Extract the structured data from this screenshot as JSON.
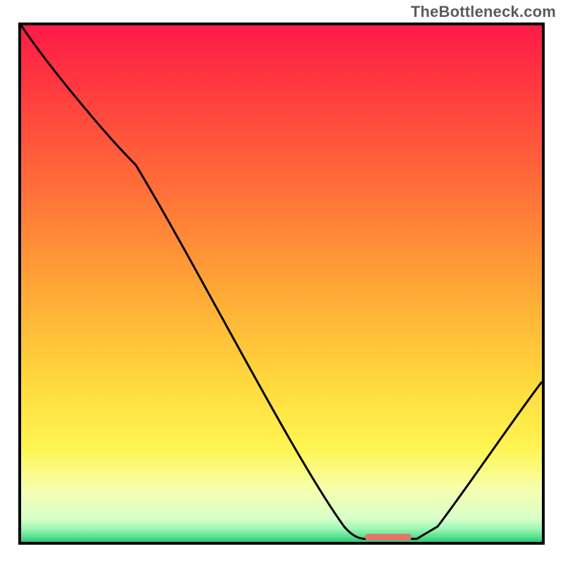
{
  "watermark": "TheBottleneck.com",
  "chart_data": {
    "type": "line",
    "title": "",
    "xlabel": "",
    "ylabel": "",
    "xlim": [
      0,
      100
    ],
    "ylim": [
      0,
      100
    ],
    "gradient_stops": [
      {
        "offset": 0,
        "color": "#ff1a47"
      },
      {
        "offset": 0.12,
        "color": "#ff3a3f"
      },
      {
        "offset": 0.3,
        "color": "#ff6a3a"
      },
      {
        "offset": 0.5,
        "color": "#ffa436"
      },
      {
        "offset": 0.68,
        "color": "#ffd63c"
      },
      {
        "offset": 0.82,
        "color": "#fff552"
      },
      {
        "offset": 0.9,
        "color": "#f6ffb0"
      },
      {
        "offset": 0.955,
        "color": "#d8ffca"
      },
      {
        "offset": 0.975,
        "color": "#9cf7b4"
      },
      {
        "offset": 0.99,
        "color": "#58e191"
      },
      {
        "offset": 1.0,
        "color": "#2bc878"
      }
    ],
    "series": [
      {
        "name": "curve",
        "points": [
          {
            "x": 0,
            "y": 100
          },
          {
            "x": 22,
            "y": 73
          },
          {
            "x": 62,
            "y": 3
          },
          {
            "x": 66,
            "y": 0.6
          },
          {
            "x": 76,
            "y": 0.6
          },
          {
            "x": 80,
            "y": 3
          },
          {
            "x": 100,
            "y": 31
          }
        ]
      }
    ],
    "marker": {
      "x_start": 66,
      "x_end": 75,
      "y": 0.9,
      "color": "#e5736b"
    }
  }
}
